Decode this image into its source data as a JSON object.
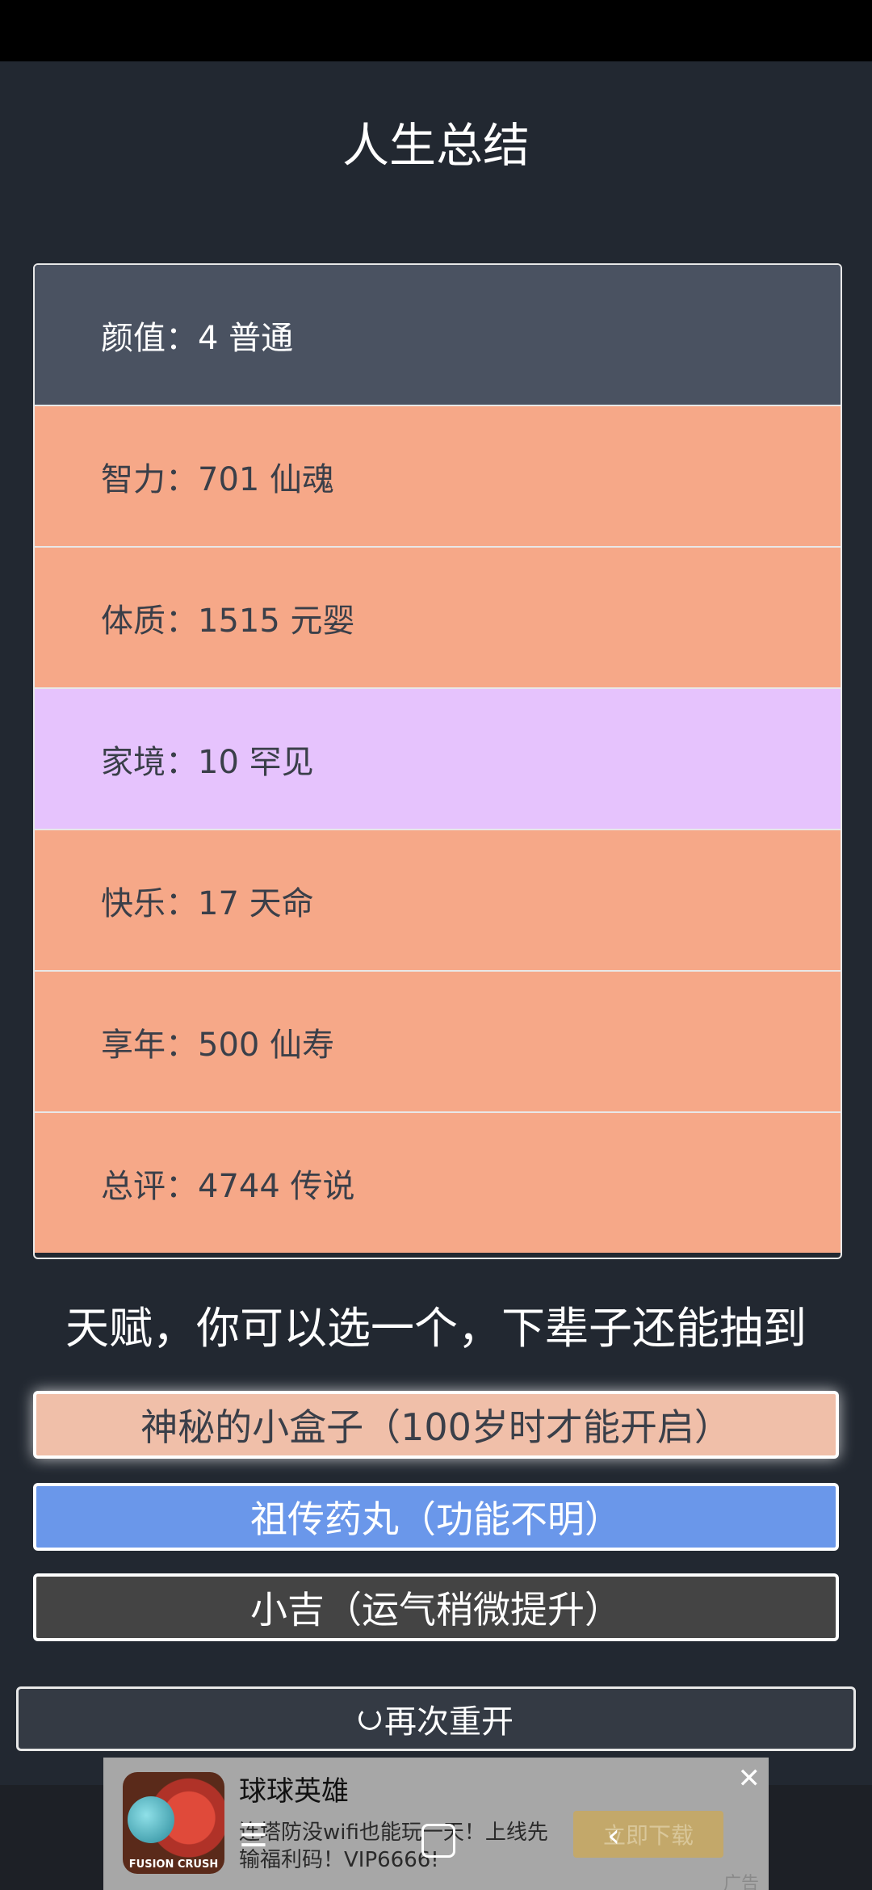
{
  "page": {
    "title": "人生总结"
  },
  "stats": [
    {
      "text": "颜值：4 普通",
      "tier": "gray",
      "color": "#4a5261"
    },
    {
      "text": "智力：701 仙魂",
      "tier": "orange",
      "color": "#f6a888"
    },
    {
      "text": "体质：1515 元婴",
      "tier": "orange",
      "color": "#f6a888"
    },
    {
      "text": "家境：10 罕见",
      "tier": "purple",
      "color": "#e6c3fd"
    },
    {
      "text": "快乐：17 天命",
      "tier": "orange",
      "color": "#f6a888"
    },
    {
      "text": "享年：500 仙寿",
      "tier": "orange",
      "color": "#f6a888"
    },
    {
      "text": "总评：4744 传说",
      "tier": "orange",
      "color": "#f6a888"
    }
  ],
  "talents": {
    "heading": "天赋，你可以选一个，下辈子还能抽到",
    "options": [
      {
        "label": "神秘的小盒子（100岁时才能开启）",
        "color": "#f0bfa9",
        "selected": true
      },
      {
        "label": "祖传药丸（功能不明）",
        "color": "#6a97ea"
      },
      {
        "label": "小吉（运气稍微提升）",
        "color": "#444444"
      }
    ]
  },
  "restart": {
    "label": "再次重开",
    "icon": "refresh-icon"
  },
  "ad": {
    "title": "球球英雄",
    "description": "连塔防没wifi也能玩一天！上线先输福利码！VIP6666!",
    "cta": "立即下载",
    "close": "✕",
    "label": "广告",
    "app_brand": "FUSION CRUSH"
  },
  "nav": {
    "menu": "☰",
    "back": "‹"
  }
}
